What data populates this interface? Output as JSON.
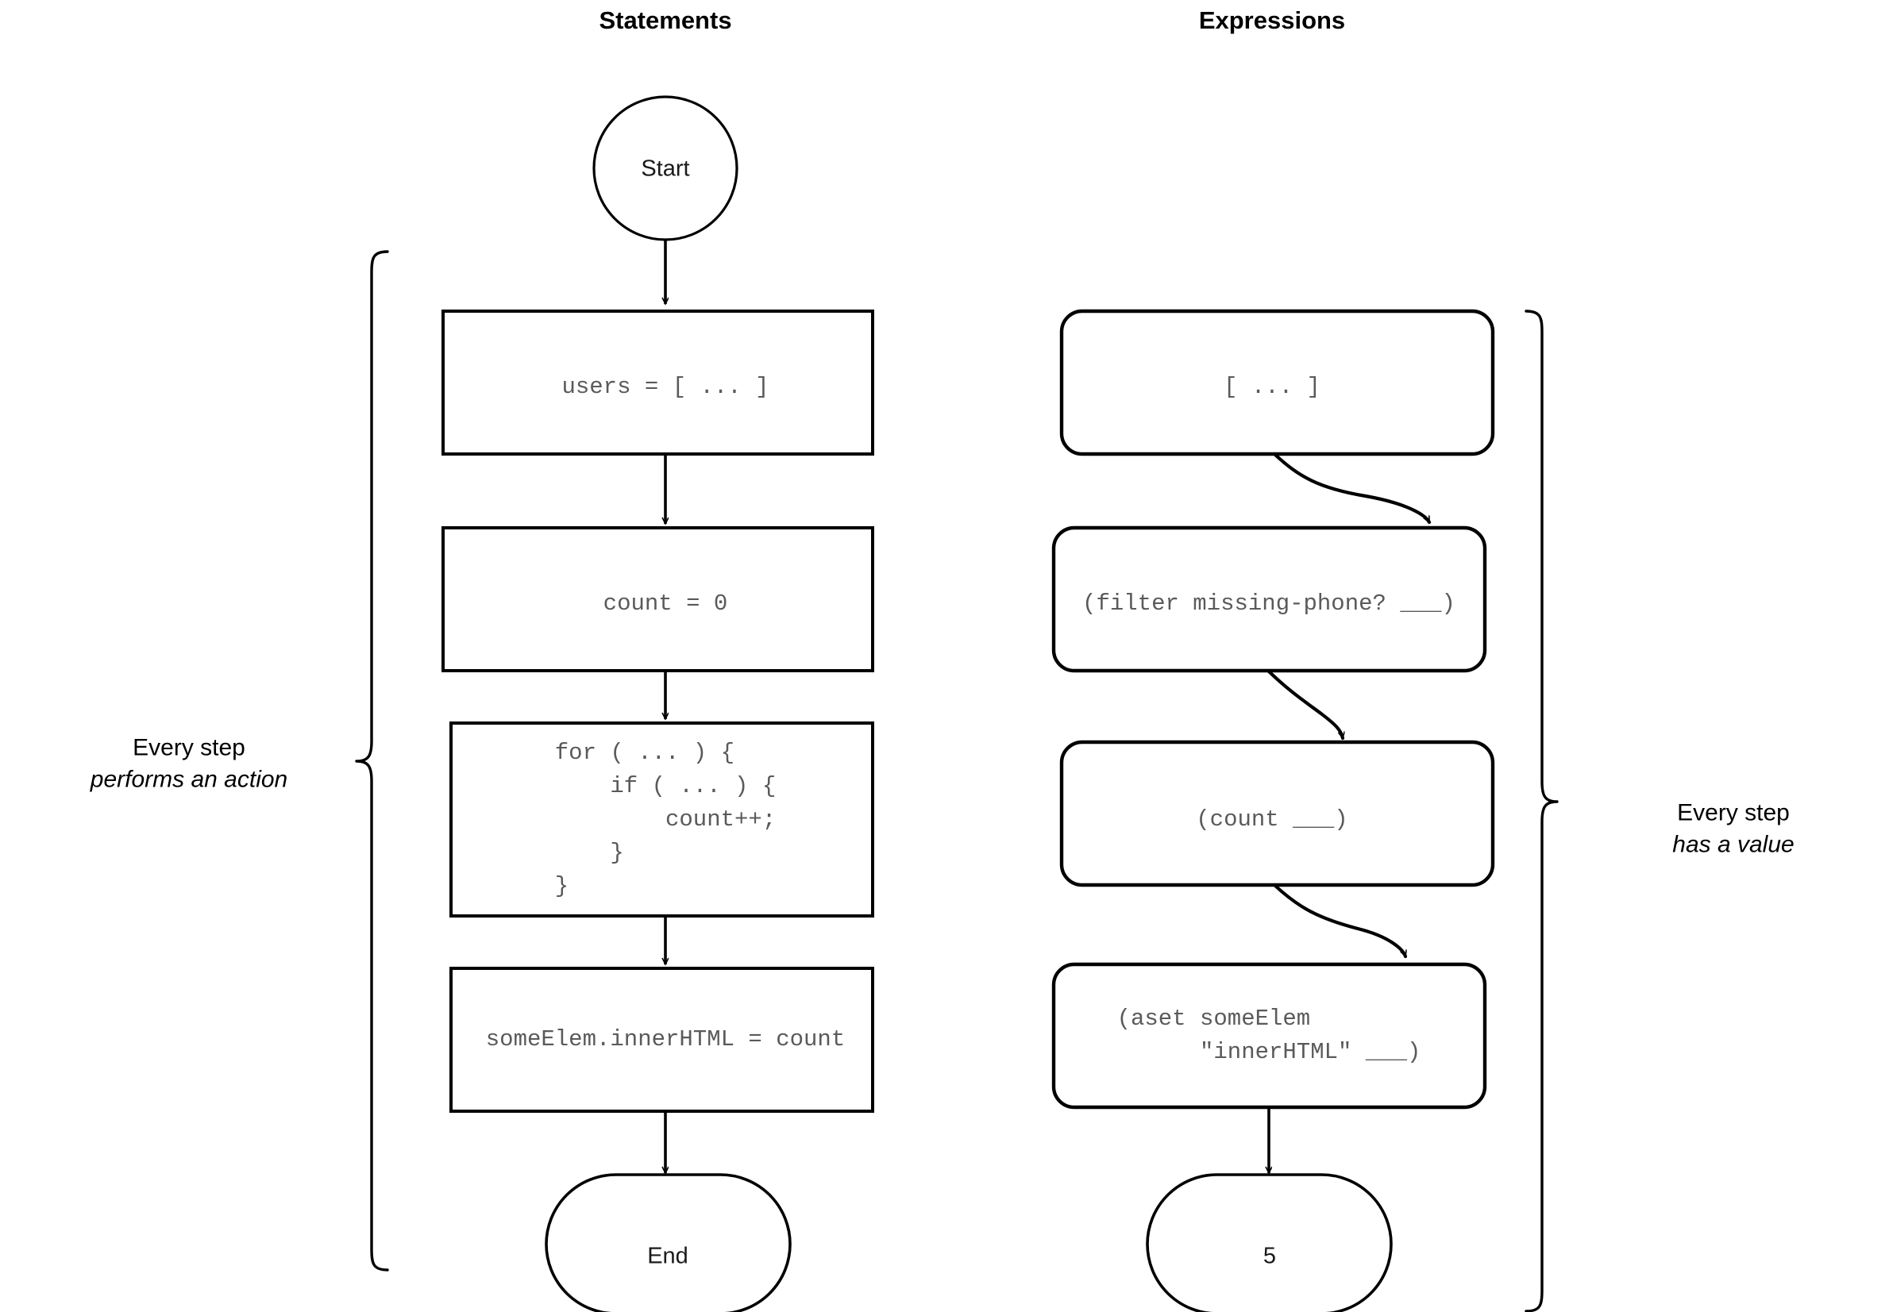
{
  "columns": [
    {
      "id": "statements",
      "title": "Statements"
    },
    {
      "id": "expressions",
      "title": "Expressions"
    }
  ],
  "statements_flow": {
    "start_label": "Start",
    "end_label": "End",
    "steps": [
      {
        "id": "assign-users",
        "code": "users = [ ... ]"
      },
      {
        "id": "assign-count",
        "code": "count = 0"
      },
      {
        "id": "for-loop",
        "code": "for ( ... ) {\n    if ( ... ) {\n        count++;\n    }\n}"
      },
      {
        "id": "set-innerhtml",
        "code": "someElem.innerHTML = count"
      }
    ]
  },
  "expressions_flow": {
    "result_label": "5",
    "steps": [
      {
        "id": "array-literal",
        "code": "[ ... ]"
      },
      {
        "id": "filter-expr",
        "code": "(filter missing-phone? ___)"
      },
      {
        "id": "count-expr",
        "code": "(count ___)"
      },
      {
        "id": "aset-expr",
        "code": "(aset someElem\n      \"innerHTML\" ___)"
      }
    ]
  },
  "annotations": {
    "left": {
      "line1": "Every step",
      "line2": "performs an action"
    },
    "right": {
      "line1": "Every step",
      "line2": "has a value"
    }
  },
  "style": {
    "stroke": "#000000",
    "code_text_color": "#5a5a5a",
    "label_text_color": "#1a1a1a",
    "background": "#ffffff"
  }
}
